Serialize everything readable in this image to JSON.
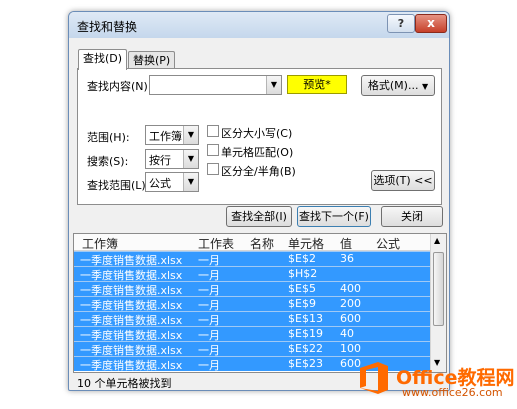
{
  "dialog": {
    "title": "查找和替换",
    "help_label": "?",
    "close_label": "x"
  },
  "tabs": [
    {
      "label": "查找(D)"
    },
    {
      "label": "替换(P)"
    }
  ],
  "find": {
    "content_label": "查找内容(N):",
    "content_value": "",
    "preview_label": "预览*",
    "format_button": "格式(M)...",
    "scope_label": "范围(H):",
    "scope_value": "工作簿",
    "search_label": "搜索(S):",
    "search_value": "按行",
    "lookin_label": "查找范围(L):",
    "lookin_value": "公式",
    "match_case_label": "区分大小写(C)",
    "match_cell_label": "单元格匹配(O)",
    "match_width_label": "区分全/半角(B)",
    "options_button": "选项(T) <<"
  },
  "actions": {
    "find_all": "查找全部(I)",
    "find_next": "查找下一个(F)",
    "close": "关闭"
  },
  "results": {
    "columns": [
      "工作簿",
      "工作表",
      "名称",
      "单元格",
      "值",
      "公式"
    ],
    "rows": [
      {
        "book": "一季度销售数据.xlsx",
        "sheet": "一月",
        "name": "",
        "cell": "$E$2",
        "value": "36",
        "formula": ""
      },
      {
        "book": "一季度销售数据.xlsx",
        "sheet": "一月",
        "name": "",
        "cell": "$H$2",
        "value": "",
        "formula": ""
      },
      {
        "book": "一季度销售数据.xlsx",
        "sheet": "一月",
        "name": "",
        "cell": "$E$5",
        "value": "400",
        "formula": ""
      },
      {
        "book": "一季度销售数据.xlsx",
        "sheet": "一月",
        "name": "",
        "cell": "$E$9",
        "value": "200",
        "formula": ""
      },
      {
        "book": "一季度销售数据.xlsx",
        "sheet": "一月",
        "name": "",
        "cell": "$E$13",
        "value": "600",
        "formula": ""
      },
      {
        "book": "一季度销售数据.xlsx",
        "sheet": "一月",
        "name": "",
        "cell": "$E$19",
        "value": "40",
        "formula": ""
      },
      {
        "book": "一季度销售数据.xlsx",
        "sheet": "一月",
        "name": "",
        "cell": "$E$22",
        "value": "100",
        "formula": ""
      },
      {
        "book": "一季度销售数据.xlsx",
        "sheet": "一月",
        "name": "",
        "cell": "$E$23",
        "value": "600",
        "formula": ""
      }
    ],
    "status": "10 个单元格被找到"
  },
  "watermark": {
    "brand": "Office教程网",
    "url": "www.office26.com",
    "color": "#ff6a00"
  }
}
